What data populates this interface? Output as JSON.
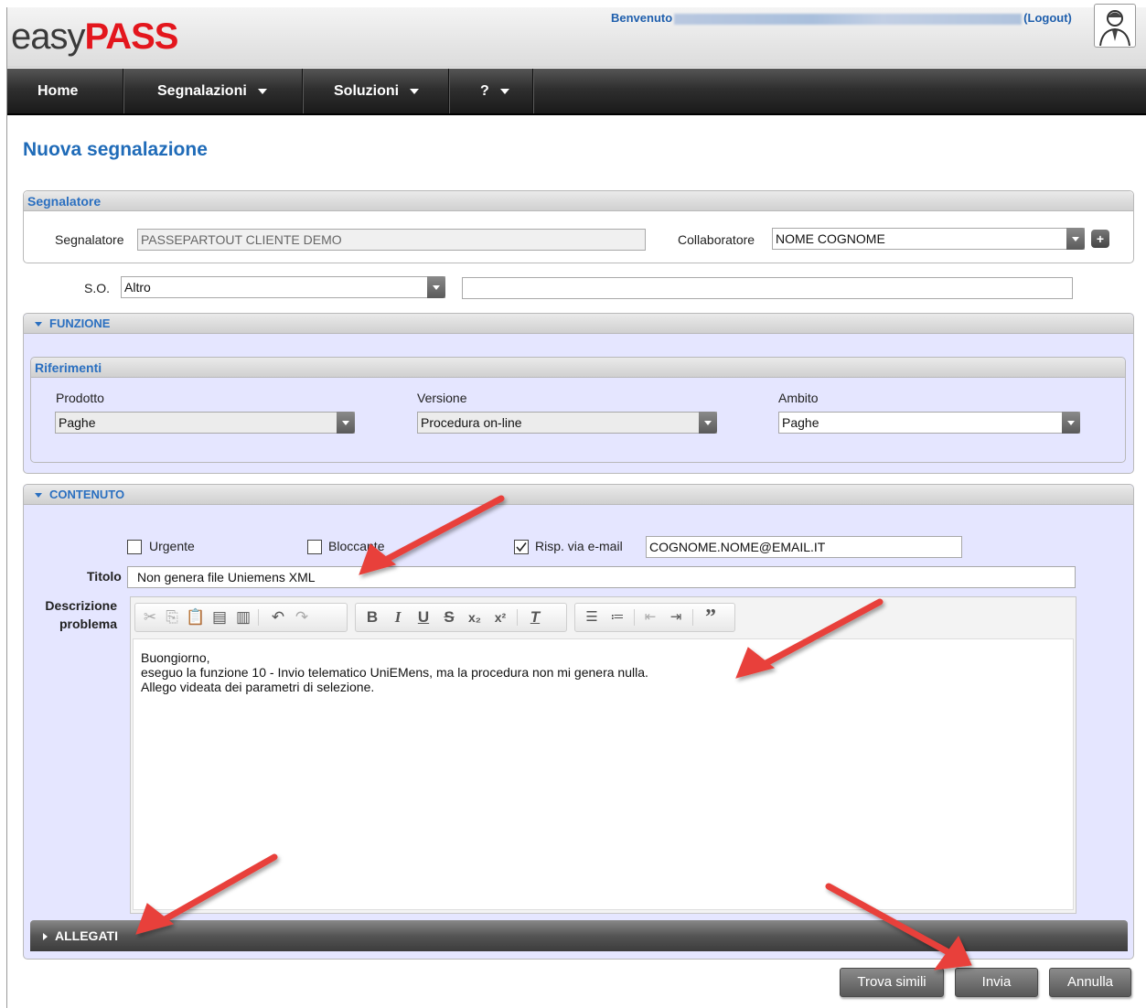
{
  "header": {
    "logo_light": "easy",
    "logo_bold": "PASS",
    "welcome_label": "Benvenuto",
    "logout": "(Logout)"
  },
  "nav": {
    "items": [
      {
        "label": "Home"
      },
      {
        "label": "Segnalazioni"
      },
      {
        "label": "Soluzioni"
      },
      {
        "label": "?"
      }
    ]
  },
  "page_title": "Nuova segnalazione",
  "segnalatore_panel": {
    "title": "Segnalatore",
    "segnalatore_label": "Segnalatore",
    "segnalatore_value": "PASSEPARTOUT CLIENTE DEMO",
    "collaboratore_label": "Collaboratore",
    "collaboratore_value": "NOME COGNOME"
  },
  "so": {
    "label": "S.O.",
    "value": "Altro",
    "extra_value": ""
  },
  "funzione_panel": {
    "title": "FUNZIONE",
    "riferimenti_title": "Riferimenti",
    "prodotto_label": "Prodotto",
    "prodotto_value": "Paghe",
    "versione_label": "Versione",
    "versione_value": "Procedura on-line",
    "ambito_label": "Ambito",
    "ambito_value": "Paghe"
  },
  "contenuto_panel": {
    "title": "CONTENUTO",
    "urgente_label": "Urgente",
    "urgente_checked": false,
    "bloccante_label": "Bloccante",
    "bloccante_checked": false,
    "email_label": "Risp. via e-mail",
    "email_checked": true,
    "email_value": "COGNOME.NOME@EMAIL.IT",
    "titolo_label": "Titolo",
    "titolo_value": "Non genera file Uniemens XML",
    "descrizione_label_1": "Descrizione",
    "descrizione_label_2": "problema",
    "body_line_1": "Buongiorno,",
    "body_line_2": "eseguo la funzione 10 - Invio telematico UniEMens, ma la procedura non mi genera nulla.",
    "body_line_3": "Allego videata dei parametri di selezione."
  },
  "allegati": {
    "title": "ALLEGATI"
  },
  "buttons": {
    "trova_simili": "Trova simili",
    "invia": "Invia",
    "annulla": "Annulla"
  },
  "colors": {
    "brand_red": "#e3161d",
    "link_blue": "#1f6bb8",
    "panel_bg": "#e5e6ff",
    "annotation_arrow": "#e8403a"
  },
  "icons": {
    "toolbar": [
      "cut-icon",
      "copy-icon",
      "paste-icon",
      "paste-text-icon",
      "paste-word-icon",
      "undo-icon",
      "redo-icon",
      "bold-icon",
      "italic-icon",
      "underline-icon",
      "strikethrough-icon",
      "subscript-icon",
      "superscript-icon",
      "remove-format-icon",
      "numbered-list-icon",
      "bulleted-list-icon",
      "outdent-icon",
      "indent-icon",
      "blockquote-icon"
    ]
  }
}
